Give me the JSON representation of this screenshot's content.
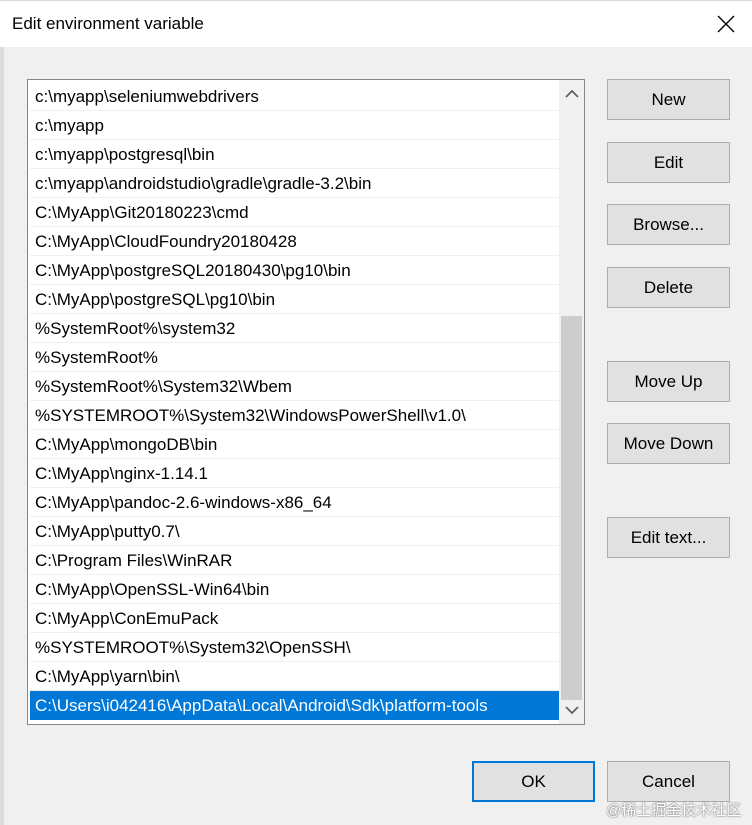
{
  "window": {
    "title": "Edit environment variable"
  },
  "list": {
    "items": [
      "c:\\myapp\\seleniumwebdrivers",
      "c:\\myapp",
      "c:\\myapp\\postgresql\\bin",
      "c:\\myapp\\androidstudio\\gradle\\gradle-3.2\\bin",
      "C:\\MyApp\\Git20180223\\cmd",
      "C:\\MyApp\\CloudFoundry20180428",
      "C:\\MyApp\\postgreSQL20180430\\pg10\\bin",
      "C:\\MyApp\\postgreSQL\\pg10\\bin",
      "%SystemRoot%\\system32",
      "%SystemRoot%",
      "%SystemRoot%\\System32\\Wbem",
      "%SYSTEMROOT%\\System32\\WindowsPowerShell\\v1.0\\",
      "C:\\MyApp\\mongoDB\\bin",
      "C:\\MyApp\\nginx-1.14.1",
      "C:\\MyApp\\pandoc-2.6-windows-x86_64",
      "C:\\MyApp\\putty0.7\\",
      "C:\\Program Files\\WinRAR",
      "C:\\MyApp\\OpenSSL-Win64\\bin",
      "C:\\MyApp\\ConEmuPack",
      "%SYSTEMROOT%\\System32\\OpenSSH\\",
      "C:\\MyApp\\yarn\\bin\\",
      "C:\\Users\\i042416\\AppData\\Local\\Android\\Sdk\\platform-tools"
    ],
    "selected_index": 21
  },
  "buttons": {
    "new": "New",
    "edit": "Edit",
    "browse": "Browse...",
    "delete": "Delete",
    "move_up": "Move Up",
    "move_down": "Move Down",
    "edit_text": "Edit text...",
    "ok": "OK",
    "cancel": "Cancel"
  },
  "watermark": "@稀土掘金技术社区",
  "colors": {
    "selection": "#0078d7",
    "button_face": "#e1e1e1",
    "dialog_bg": "#f0f0f0"
  }
}
